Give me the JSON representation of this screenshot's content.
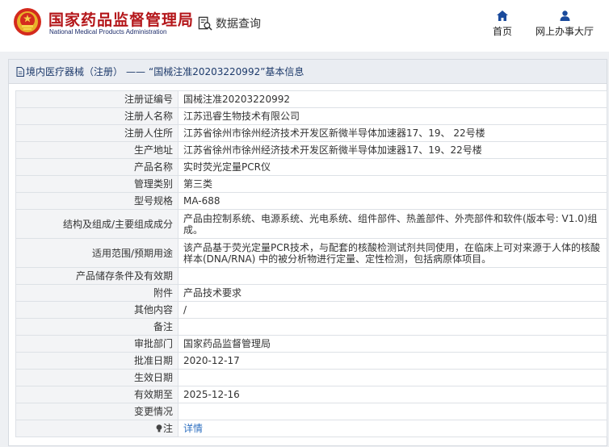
{
  "header": {
    "brand_cn": "国家药品监督管理局",
    "brand_en": "National Medical Products Administration",
    "query_label": "数据查询",
    "nav_home": "首页",
    "nav_hall": "网上办事大厅",
    "accent_color": "#b4161a",
    "nav_color": "#1a4a9c"
  },
  "breadcrumb": {
    "category": "境内医疗器械（注册）",
    "separator": "——",
    "title": "“国械注准20203220992”基本信息"
  },
  "rows": [
    {
      "label": "注册证编号",
      "value": "国械注准20203220992"
    },
    {
      "label": "注册人名称",
      "value": "江苏迅睿生物技术有限公司"
    },
    {
      "label": "注册人住所",
      "value": "江苏省徐州市徐州经济技术开发区新微半导体加速器17、19、 22号楼"
    },
    {
      "label": "生产地址",
      "value": "江苏省徐州市徐州经济技术开发区新微半导体加速器17、19、22号楼"
    },
    {
      "label": "产品名称",
      "value": "实时荧光定量PCR仪"
    },
    {
      "label": "管理类别",
      "value": "第三类"
    },
    {
      "label": "型号规格",
      "value": "MA-688"
    },
    {
      "label": "结构及组成/主要组成成分",
      "value": "产品由控制系统、电源系统、光电系统、组件部件、热盖部件、外壳部件和软件(版本号: V1.0)组成。"
    },
    {
      "label": "适用范围/预期用途",
      "value": "该产品基于荧光定量PCR技术，与配套的核酸检测试剂共同使用，在临床上可对来源于人体的核酸样本(DNA/RNA) 中的被分析物进行定量、定性检测，包括病原体项目。"
    },
    {
      "label": "产品储存条件及有效期",
      "value": ""
    },
    {
      "label": "附件",
      "value": "产品技术要求"
    },
    {
      "label": "其他内容",
      "value": "/"
    },
    {
      "label": "备注",
      "value": ""
    },
    {
      "label": "审批部门",
      "value": "国家药品监督管理局"
    },
    {
      "label": "批准日期",
      "value": "2020-12-17"
    },
    {
      "label": "生效日期",
      "value": ""
    },
    {
      "label": "有效期至",
      "value": "2025-12-16"
    },
    {
      "label": "变更情况",
      "value": ""
    }
  ],
  "note_row": {
    "label": "注",
    "link": "详情",
    "icon": "bulb-icon"
  }
}
